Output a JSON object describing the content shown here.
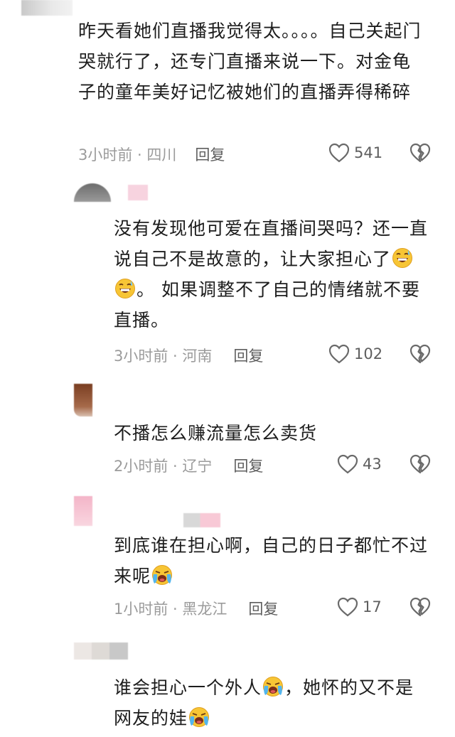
{
  "comments": [
    {
      "text": "昨天看她们直播我觉得太。。。。自己关起门哭就行了，还专门直播来说一下。对金龟子的童年美好记忆被她们的直播弄得稀碎",
      "meta": "3小时前 · 四川",
      "reply": "回复",
      "likes": "541"
    },
    {
      "text_a": "没有发现他可爱在直播间哭吗？还一直说自己不是故意的，让大家担心了",
      "text_b": "。 如果调整不了自己的情绪就不要直播。",
      "meta": "3小时前 · 河南",
      "reply": "回复",
      "likes": "102"
    },
    {
      "text": "不播怎么赚流量怎么卖货",
      "meta": "2小时前 · 辽宁",
      "reply": "回复",
      "likes": "43"
    },
    {
      "text": "到底谁在担心啊，自己的日子都忙不过来呢",
      "meta": "1小时前 · 黑龙江",
      "reply": "回复",
      "likes": "17"
    },
    {
      "text_a": "谁会担心一个外人",
      "text_b": "，她怀的又不是网友的娃",
      "meta": "",
      "reply": "",
      "likes": ""
    }
  ],
  "icons": {
    "like": "heart-outline-icon",
    "dislike": "broken-heart-icon",
    "emoji_sweat": "grinning-sweat-emoji",
    "emoji_cry": "loudly-crying-emoji"
  },
  "colors": {
    "text": "#1d1d1d",
    "meta": "#9b9b9b",
    "icon": "#6a6a6a"
  }
}
